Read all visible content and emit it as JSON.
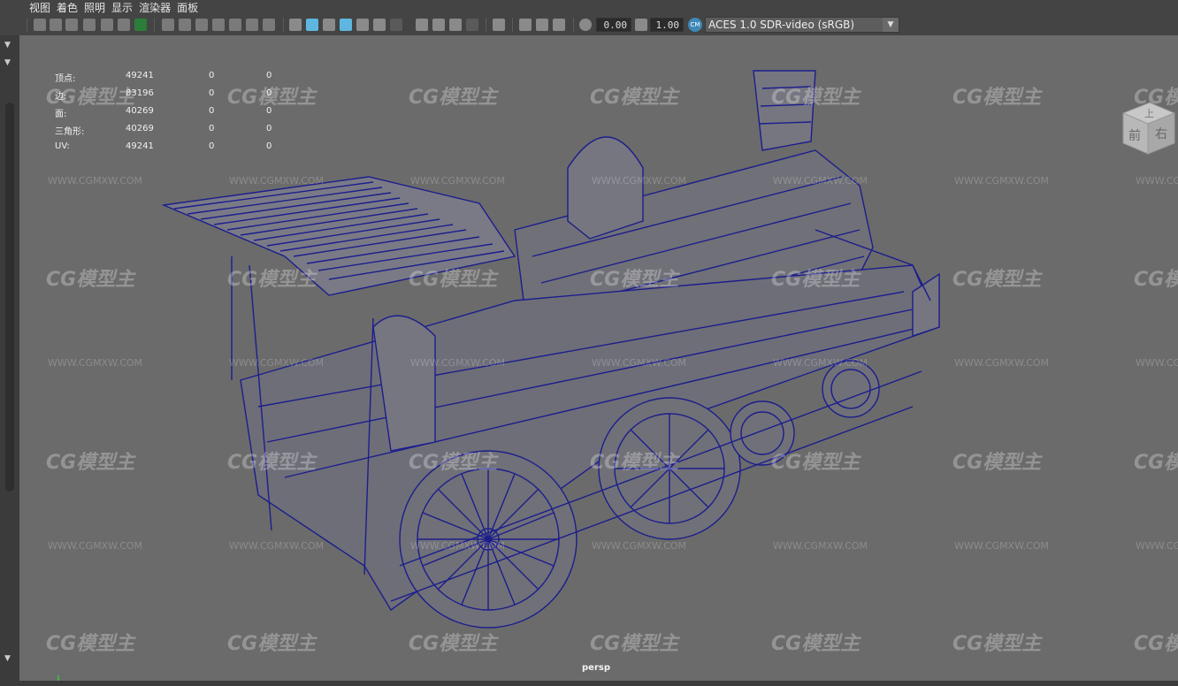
{
  "menu": [
    "视图",
    "着色",
    "照明",
    "显示",
    "渲染器",
    "面板"
  ],
  "toolbar": {
    "field_a": "0.00",
    "field_b": "1.00",
    "colorspace": "ACES 1.0 SDR-video (sRGB)",
    "cm_badge": "CM"
  },
  "hud": {
    "rows": [
      {
        "label": "顶点:",
        "v1": "49241",
        "v2": "0",
        "v3": "0"
      },
      {
        "label": "边:",
        "v1": "83196",
        "v2": "0",
        "v3": "0"
      },
      {
        "label": "面:",
        "v1": "40269",
        "v2": "0",
        "v3": "0"
      },
      {
        "label": "三角形:",
        "v1": "40269",
        "v2": "0",
        "v3": "0"
      },
      {
        "label": "UV:",
        "v1": "49241",
        "v2": "0",
        "v3": "0"
      }
    ]
  },
  "viewcube": {
    "top": "上",
    "front": "前",
    "right": "右"
  },
  "camera_label": "persp",
  "watermark": {
    "logo": "CG模型主",
    "url": "WWW.CGMXW.COM"
  },
  "colors": {
    "wire": "#1c1e8c",
    "viewport_bg": "#6b6b6b",
    "ui_bg": "#444444",
    "accent": "#4aa8d8"
  },
  "icons": [
    "camera-icon",
    "lock-icon",
    "grid-icon",
    "wireframe-icon",
    "smooth-shade-icon",
    "texture-icon",
    "light-icon",
    "shadow-icon",
    "isolate-icon",
    "xray-icon",
    "colorspace-icon"
  ]
}
